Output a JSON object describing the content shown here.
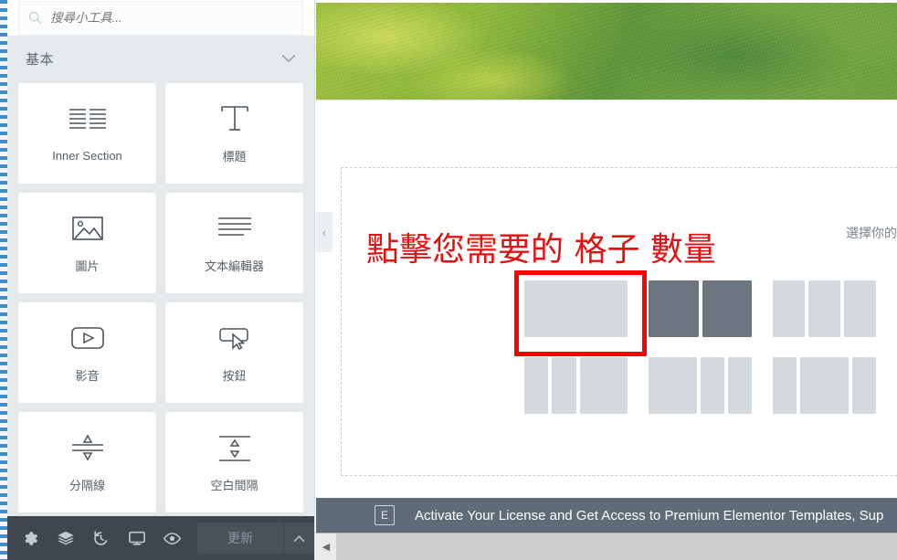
{
  "panel": {
    "search": {
      "placeholder": "搜尋小工具...",
      "value": "",
      "icon": "search-icon"
    },
    "category": {
      "label": "基本",
      "chevron": "chevron-down-icon",
      "chevron_glyph": "⌄"
    },
    "widgets": [
      {
        "label": "Inner Section",
        "icon": "inner-section-icon"
      },
      {
        "label": "標題",
        "icon": "heading-icon"
      },
      {
        "label": "圖片",
        "icon": "image-icon"
      },
      {
        "label": "文本編輯器",
        "icon": "text-editor-icon"
      },
      {
        "label": "影音",
        "icon": "video-icon"
      },
      {
        "label": "按鈕",
        "icon": "button-icon"
      },
      {
        "label": "分隔線",
        "icon": "divider-icon"
      },
      {
        "label": "空白間隔",
        "icon": "spacer-icon"
      }
    ]
  },
  "toolbar": {
    "buttons": [
      {
        "name": "settings",
        "icon": "gear-icon"
      },
      {
        "name": "navigator",
        "icon": "layers-icon"
      },
      {
        "name": "history",
        "icon": "history-icon"
      },
      {
        "name": "responsive-mode",
        "icon": "monitor-icon"
      },
      {
        "name": "preview",
        "icon": "eye-icon"
      }
    ],
    "update_label": "更新",
    "update_caret_glyph": "▲"
  },
  "canvas": {
    "collapse_glyph": "‹",
    "annotation": "點擊您需要的 格子 數量",
    "annotation_color": "#e51111",
    "hint": "選擇你的",
    "hero": {
      "alt": "grass-field-photo"
    },
    "presets": [
      {
        "name": "one-column",
        "columns": [
          100
        ],
        "selected": true,
        "hovered": false
      },
      {
        "name": "two-columns",
        "columns": [
          50,
          50
        ],
        "selected": false,
        "hovered": true
      },
      {
        "name": "three-columns",
        "columns": [
          33,
          33,
          33
        ],
        "selected": false,
        "hovered": false
      },
      {
        "name": "small-small-large",
        "columns": [
          25,
          25,
          50
        ],
        "selected": false,
        "hovered": false
      },
      {
        "name": "large-small-small",
        "columns": [
          50,
          25,
          25
        ],
        "selected": false,
        "hovered": false
      },
      {
        "name": "small-large-small",
        "columns": [
          25,
          50,
          25
        ],
        "selected": false,
        "hovered": false
      }
    ]
  },
  "promo": {
    "badge": "E",
    "text": "Activate Your License and Get Access to Premium Elementor Templates, Sup"
  },
  "scrollbar": {
    "left_arrow_glyph": "◀"
  },
  "colors": {
    "panel_bg": "#e4e9ec",
    "toolbar_bg": "#3f4650",
    "preset_idle": "#d3d9dd",
    "preset_hover": "#6b757f",
    "selection_red": "#ff0000",
    "promo_bg": "#5f6c78"
  }
}
